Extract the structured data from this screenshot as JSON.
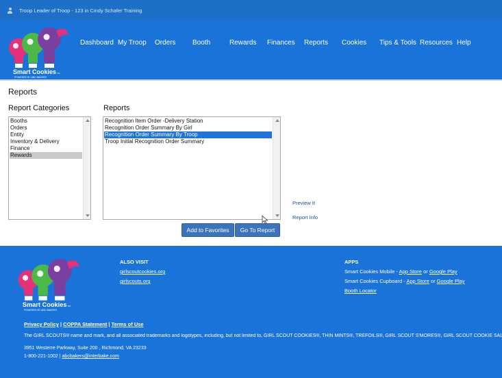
{
  "topbar": {
    "user_text": "Troop Leader of Troop - 123 in Cindy Schafer Training"
  },
  "logo": {
    "brand": "Smart Cookies",
    "tm": "TM",
    "tagline": "POWERED BY ABC BAKERS"
  },
  "nav": [
    "Dashboard",
    "My Troop",
    "Orders",
    "Booth",
    "Rewards",
    "Finances",
    "Reports",
    "Cookies",
    "Tips & Tools",
    "Resources",
    "Help"
  ],
  "page": {
    "title": "Reports",
    "categories_title": "Report Categories",
    "reports_title": "Reports"
  },
  "categories": {
    "items": [
      "Booths",
      "Orders",
      "Entity",
      "Inventory & Delivery",
      "Finance",
      "Rewards"
    ],
    "selected": "Rewards"
  },
  "reports": {
    "items": [
      "Recognition Item Order -Delivery Station",
      "Recognition Order Summary By Girl",
      "Recognition Order Summary By Troop",
      "Troop Initial Recognition Order Summary"
    ],
    "selected": "Recognition Order Summary By Troop"
  },
  "links": {
    "preview": "Preview It",
    "info": "Report Info"
  },
  "buttons": {
    "favorites": "Add to Favorites",
    "go": "Go To Report"
  },
  "footer": {
    "also_visit": "ALSO VISIT",
    "visit_links": [
      "girlscoutcookies.org",
      "girlscouts.org"
    ],
    "apps": "APPS",
    "mobile_label": "Smart Cookies Mobile - ",
    "cupboard_label": "Smart Cookies Cupboard - ",
    "app_store": "App Store",
    "or": " or ",
    "google_play": "Google Play",
    "booth_locator": "Booth Locator",
    "privacy": "Privacy Policy",
    "sep": " | ",
    "coppa": "COPPA Statement",
    "terms": "Terms of Use",
    "trademark": "The GIRL SCOUTS® name and mark, and all associated trademarks and logotypes, including, but not limited to, GIRL SCOUT COOKIES®, THIN MINTS®, TREFOILS®, GIRL SCOUT S'MORES®, GIRL SCOUT COOKIE SALE®, ...",
    "address": "3951 Westerre Parkway, Suite 200 , Richmond, VA 23233",
    "phone": "1-800-221-1002 | ",
    "email": "abcbakers@interbake.com"
  },
  "colors": {
    "brand_blue": "#1a73d9",
    "topbar_blue": "#1d6fc7",
    "button_blue": "#3b74ba",
    "selected_blue": "#1e74d8",
    "logo_pink": "#e5307a",
    "logo_green": "#4cb848",
    "logo_purple": "#7a3fa0"
  }
}
